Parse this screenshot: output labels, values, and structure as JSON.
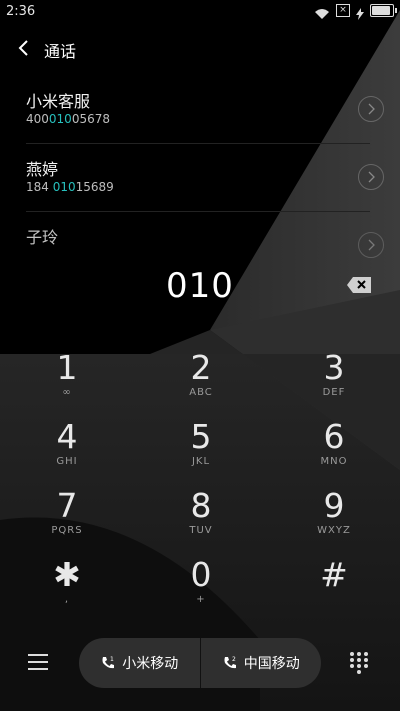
{
  "status": {
    "time": "2:36",
    "sim_glyph": "×"
  },
  "header": {
    "title": "通话"
  },
  "contacts": [
    {
      "name": "小米客服",
      "number_parts": [
        "400",
        "010",
        "05678"
      ]
    },
    {
      "name": "燕婷",
      "number_parts": [
        "184 ",
        "010",
        "15689"
      ]
    },
    {
      "name": "子玲",
      "number_parts": [
        "",
        "",
        ""
      ]
    }
  ],
  "display": {
    "digits": "010"
  },
  "keypad": [
    {
      "digit": "1",
      "sub": "∞"
    },
    {
      "digit": "2",
      "sub": "ABC"
    },
    {
      "digit": "3",
      "sub": "DEF"
    },
    {
      "digit": "4",
      "sub": "GHI"
    },
    {
      "digit": "5",
      "sub": "JKL"
    },
    {
      "digit": "6",
      "sub": "MNO"
    },
    {
      "digit": "7",
      "sub": "PQRS"
    },
    {
      "digit": "8",
      "sub": "TUV"
    },
    {
      "digit": "9",
      "sub": "WXYZ"
    },
    {
      "digit": "✱",
      "sub": ","
    },
    {
      "digit": "0",
      "sub": "+"
    },
    {
      "digit": "#",
      "sub": ""
    }
  ],
  "call": {
    "sim1_label": "小米移动",
    "sim2_label": "中国移动"
  },
  "colors": {
    "accent": "#27c0bd",
    "background": "#000000",
    "pill": "#2f2f2f"
  },
  "icons": {
    "back": "chevron-left-icon",
    "backspace": "backspace-icon",
    "menu": "hamburger-icon",
    "dialpad": "dialpad-icon",
    "contact_arrow": "chevron-right-circle-icon"
  }
}
